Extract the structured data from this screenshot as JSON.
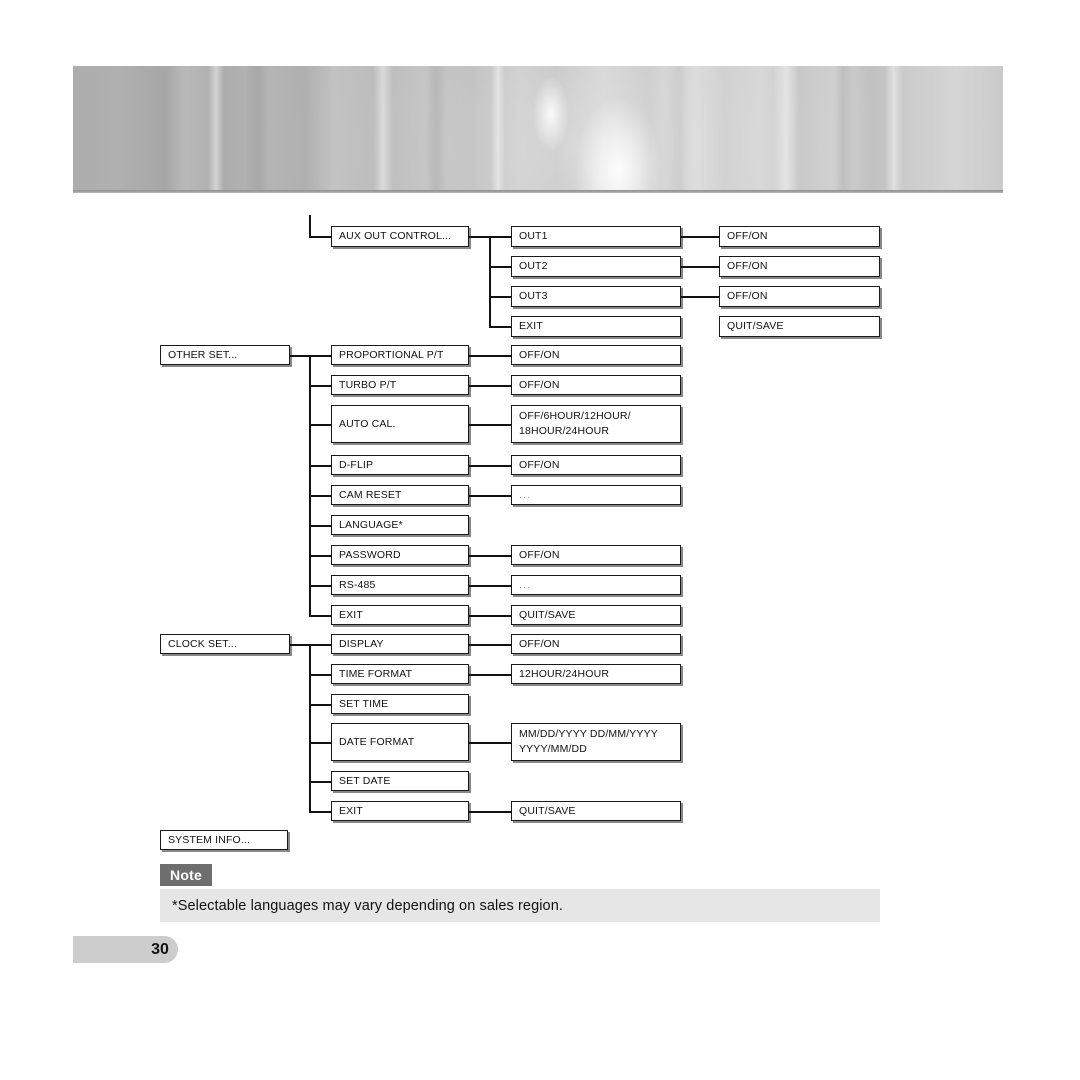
{
  "page": {
    "number": "30",
    "banner": {
      "kind": "camera-lens-photo-banner"
    }
  },
  "note": {
    "label": "Note",
    "text": "*Selectable languages may vary depending on sales region."
  },
  "tree": {
    "groups": [
      {
        "id": "aux-out-control",
        "root": {
          "label": "AUX OUT CONTROL..."
        },
        "children": [
          {
            "label": "OUT1",
            "value": "OFF/ON"
          },
          {
            "label": "OUT2",
            "value": "OFF/ON"
          },
          {
            "label": "OUT3",
            "value": "OFF/ON"
          },
          {
            "label": "EXIT",
            "value": "QUIT/SAVE"
          }
        ]
      },
      {
        "id": "other-set",
        "root": {
          "label": "OTHER SET..."
        },
        "children": [
          {
            "label": "PROPORTIONAL P/T",
            "value": "OFF/ON"
          },
          {
            "label": "TURBO P/T",
            "value": "OFF/ON"
          },
          {
            "label": "AUTO CAL.",
            "value": "OFF/6HOUR/12HOUR/\n18HOUR/24HOUR"
          },
          {
            "label": "D-FLIP",
            "value": "OFF/ON"
          },
          {
            "label": "CAM RESET",
            "value": "..."
          },
          {
            "label": "LANGUAGE*",
            "value": null
          },
          {
            "label": "PASSWORD",
            "value": "OFF/ON"
          },
          {
            "label": "RS-485",
            "value": "..."
          },
          {
            "label": "EXIT",
            "value": "QUIT/SAVE"
          }
        ]
      },
      {
        "id": "clock-set",
        "root": {
          "label": "CLOCK SET..."
        },
        "children": [
          {
            "label": "DISPLAY",
            "value": "OFF/ON"
          },
          {
            "label": "TIME FORMAT",
            "value": "12HOUR/24HOUR"
          },
          {
            "label": "SET TIME",
            "value": null
          },
          {
            "label": "DATE FORMAT",
            "value": "MM/DD/YYYY DD/MM/YYYY\nYYYY/MM/DD"
          },
          {
            "label": "SET DATE",
            "value": null
          },
          {
            "label": "EXIT",
            "value": "QUIT/SAVE"
          }
        ]
      },
      {
        "id": "system-info",
        "root": {
          "label": "SYSTEM INFO..."
        },
        "children": []
      }
    ]
  },
  "colors": {
    "note_tab_bg": "#6e6e6e",
    "note_body_bg": "#e6e6e6",
    "page_bar_bg": "#cdcdcd",
    "line": "#111111"
  }
}
